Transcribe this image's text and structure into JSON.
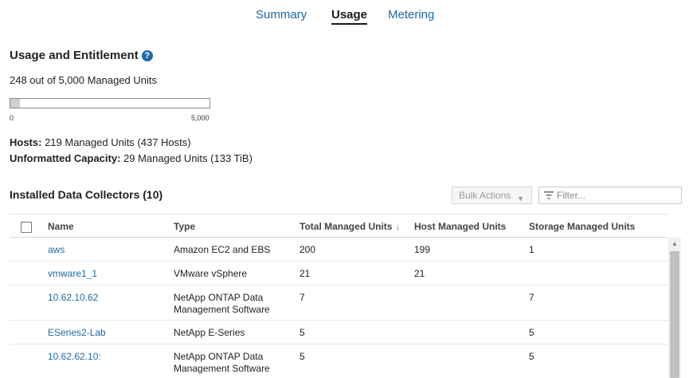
{
  "tabs": [
    {
      "label": "Summary",
      "active": false
    },
    {
      "label": "Usage",
      "active": true
    },
    {
      "label": "Metering",
      "active": false
    }
  ],
  "usage": {
    "title": "Usage and Entitlement",
    "help_icon": "help-circle-icon",
    "summary": "248 out of 5,000 Managed Units",
    "progress_fraction": 0.0496,
    "progress_min": "0",
    "progress_max": "5,000",
    "hosts_label": "Hosts:",
    "hosts_value": " 219 Managed Units (437 Hosts)",
    "capacity_label": "Unformatted Capacity:",
    "capacity_value": " 29 Managed Units (133 TiB)"
  },
  "collectors": {
    "title": "Installed Data Collectors (10)",
    "bulk_actions_label": "Bulk Actions",
    "filter_placeholder": "Filter...",
    "columns": {
      "name": "Name",
      "type": "Type",
      "total": "Total Managed Units",
      "sort_indicator": "↓",
      "host": "Host Managed Units",
      "storage": "Storage Managed Units"
    },
    "rows": [
      {
        "name": "aws",
        "type_line1": "Amazon EC2 and EBS",
        "type_line2": "",
        "total": "200",
        "host": "199",
        "storage": "1"
      },
      {
        "name": "vmware1_1",
        "type_line1": "VMware vSphere",
        "type_line2": "",
        "total": "21",
        "host": "21",
        "storage": ""
      },
      {
        "name": "10.62.10.62",
        "type_line1": "NetApp ONTAP Data",
        "type_line2": "Management Software",
        "total": "7",
        "host": "",
        "storage": "7"
      },
      {
        "name": "ESeries2-Lab",
        "type_line1": "NetApp E-Series",
        "type_line2": "",
        "total": "5",
        "host": "",
        "storage": "5"
      },
      {
        "name": "10.62.62.10:",
        "type_line1": "NetApp ONTAP Data",
        "type_line2": "Management Software",
        "total": "5",
        "host": "",
        "storage": "5"
      }
    ]
  },
  "colors": {
    "accent": "#1b6aa8",
    "progress_fill": "#d0d0d0"
  }
}
